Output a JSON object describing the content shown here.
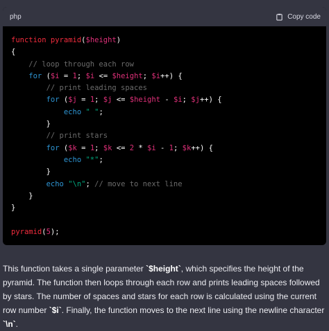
{
  "code_block": {
    "language": "php",
    "copy_label": "Copy code",
    "copy_icon": "clipboard-icon",
    "lines": [
      [
        [
          "fn",
          "function "
        ],
        [
          "fn",
          "pyramid"
        ],
        [
          "pun",
          "("
        ],
        [
          "var",
          "$height"
        ],
        [
          "pun",
          ")"
        ]
      ],
      [
        [
          "pun",
          "{"
        ]
      ],
      [
        [
          "cm",
          "    // loop through each row"
        ]
      ],
      [
        [
          "kw",
          "    for "
        ],
        [
          "pun",
          "("
        ],
        [
          "var",
          "$i"
        ],
        [
          "pun",
          " = "
        ],
        [
          "num",
          "1"
        ],
        [
          "pun",
          "; "
        ],
        [
          "var",
          "$i"
        ],
        [
          "pun",
          " <= "
        ],
        [
          "var",
          "$height"
        ],
        [
          "pun",
          "; "
        ],
        [
          "var",
          "$i"
        ],
        [
          "pun",
          "++) {"
        ]
      ],
      [
        [
          "cm",
          "        // print leading spaces"
        ]
      ],
      [
        [
          "kw",
          "        for "
        ],
        [
          "pun",
          "("
        ],
        [
          "var",
          "$j"
        ],
        [
          "pun",
          " = "
        ],
        [
          "num",
          "1"
        ],
        [
          "pun",
          "; "
        ],
        [
          "var",
          "$j"
        ],
        [
          "pun",
          " <= "
        ],
        [
          "var",
          "$height"
        ],
        [
          "pun",
          " - "
        ],
        [
          "var",
          "$i"
        ],
        [
          "pun",
          "; "
        ],
        [
          "var",
          "$j"
        ],
        [
          "pun",
          "++) {"
        ]
      ],
      [
        [
          "kw",
          "            echo "
        ],
        [
          "str",
          "\" \""
        ],
        [
          "pun",
          ";"
        ]
      ],
      [
        [
          "pun",
          "        }"
        ]
      ],
      [
        [
          "cm",
          "        // print stars"
        ]
      ],
      [
        [
          "kw",
          "        for "
        ],
        [
          "pun",
          "("
        ],
        [
          "var",
          "$k"
        ],
        [
          "pun",
          " = "
        ],
        [
          "num",
          "1"
        ],
        [
          "pun",
          "; "
        ],
        [
          "var",
          "$k"
        ],
        [
          "pun",
          " <= "
        ],
        [
          "num",
          "2"
        ],
        [
          "pun",
          " * "
        ],
        [
          "var",
          "$i"
        ],
        [
          "pun",
          " - "
        ],
        [
          "num",
          "1"
        ],
        [
          "pun",
          "; "
        ],
        [
          "var",
          "$k"
        ],
        [
          "pun",
          "++) {"
        ]
      ],
      [
        [
          "kw",
          "            echo "
        ],
        [
          "str",
          "\"*\""
        ],
        [
          "pun",
          ";"
        ]
      ],
      [
        [
          "pun",
          "        }"
        ]
      ],
      [
        [
          "kw",
          "        echo "
        ],
        [
          "str",
          "\"\\n\""
        ],
        [
          "pun",
          "; "
        ],
        [
          "cm",
          "// move to next line"
        ]
      ],
      [
        [
          "pun",
          "    }"
        ]
      ],
      [
        [
          "pun",
          "}"
        ]
      ],
      [
        [
          "pun",
          ""
        ]
      ],
      [
        [
          "fn",
          "pyramid"
        ],
        [
          "pun",
          "("
        ],
        [
          "num",
          "5"
        ],
        [
          "pun",
          ");"
        ]
      ]
    ]
  },
  "explanation": {
    "parts": [
      [
        "text",
        "This function takes a single parameter "
      ],
      [
        "code",
        "`$height`"
      ],
      [
        "text",
        ", which specifies the height of the pyramid. The function then loops through each row and prints leading spaces followed by stars. The number of spaces and stars for each row is calculated using the current row number "
      ],
      [
        "code",
        "`$i`"
      ],
      [
        "text",
        ". Finally, the function moves to the next line using the newline character "
      ],
      [
        "code",
        "`\\n`"
      ],
      [
        "text",
        "."
      ]
    ]
  }
}
